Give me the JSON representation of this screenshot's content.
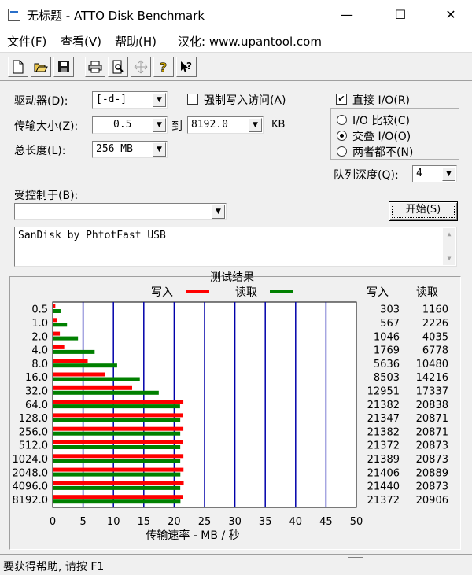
{
  "window": {
    "title": "无标题 - ATTO Disk Benchmark",
    "minimize": "—",
    "maximize": "☐",
    "close": "✕"
  },
  "menu": {
    "file": "文件(F)",
    "view": "查看(V)",
    "help": "帮助(H)",
    "localized": "汉化: www.upantool.com"
  },
  "toolbar": {
    "buttons": [
      "new-icon",
      "open-icon",
      "save-icon",
      "print-icon",
      "print-preview-icon",
      "move-icon",
      "help-icon",
      "context-help-icon"
    ]
  },
  "controls": {
    "drive_label": "驱动器(D):",
    "drive_value": "[-d-]",
    "force_write_label": "强制写入访问(A)",
    "force_write_checked": false,
    "direct_io_label": "直接 I/O(R)",
    "direct_io_checked": true,
    "transfer_label": "传输大小(Z):",
    "transfer_from": "0.5",
    "transfer_to_label": "到",
    "transfer_to": "8192.0",
    "transfer_unit": "KB",
    "total_label": "总长度(L):",
    "total_value": "256 MB",
    "io_compare_label": "I/O 比较(C)",
    "overlap_io_label": "交叠 I/O(O)",
    "neither_label": "两者都不(N)",
    "selected_mode": "overlap_io",
    "queue_label": "队列深度(Q):",
    "queue_value": "4",
    "controlled_by_label": "受控制于(B):",
    "controlled_by_value": "",
    "start_button": "开始(S)",
    "description": "SanDisk by PhtotFast USB"
  },
  "results": {
    "title": "测试结果",
    "legend_write": "写入",
    "legend_read": "读取",
    "col_write": "写入",
    "col_read": "读取",
    "x_axis_label": "传输速率 - MB / 秒",
    "write_color": "#ff0000",
    "read_color": "#008000",
    "grid_color": "#0000aa"
  },
  "chart_data": {
    "type": "bar",
    "orientation": "horizontal",
    "categories": [
      "0.5",
      "1.0",
      "2.0",
      "4.0",
      "8.0",
      "16.0",
      "32.0",
      "64.0",
      "128.0",
      "256.0",
      "512.0",
      "1024.0",
      "2048.0",
      "4096.0",
      "8192.0"
    ],
    "series": [
      {
        "name": "写入",
        "values": [
          303,
          567,
          1046,
          1769,
          5636,
          8503,
          12951,
          21382,
          21347,
          21382,
          21372,
          21389,
          21406,
          21440,
          21372
        ]
      },
      {
        "name": "读取",
        "values": [
          1160,
          2226,
          4035,
          6778,
          10480,
          14216,
          17337,
          20838,
          20871,
          20871,
          20873,
          20873,
          20889,
          20873,
          20906
        ]
      }
    ],
    "xlabel": "传输速率 - MB / 秒",
    "xlim": [
      0,
      50
    ],
    "xticks": [
      "0",
      "5",
      "10",
      "15",
      "20",
      "25",
      "30",
      "35",
      "40",
      "45",
      "50"
    ],
    "grid": true,
    "legend": "top"
  },
  "status": {
    "text": "要获得帮助, 请按 F1"
  }
}
